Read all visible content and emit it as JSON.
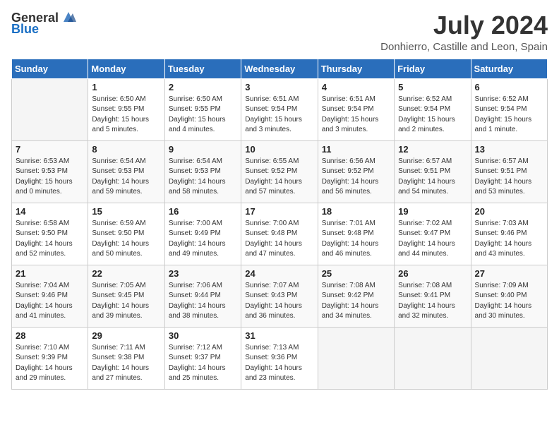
{
  "header": {
    "logo_general": "General",
    "logo_blue": "Blue",
    "month": "July 2024",
    "location": "Donhierro, Castille and Leon, Spain"
  },
  "weekdays": [
    "Sunday",
    "Monday",
    "Tuesday",
    "Wednesday",
    "Thursday",
    "Friday",
    "Saturday"
  ],
  "weeks": [
    [
      {
        "day": "",
        "sunrise": "",
        "sunset": "",
        "daylight": ""
      },
      {
        "day": "1",
        "sunrise": "Sunrise: 6:50 AM",
        "sunset": "Sunset: 9:55 PM",
        "daylight": "Daylight: 15 hours and 5 minutes."
      },
      {
        "day": "2",
        "sunrise": "Sunrise: 6:50 AM",
        "sunset": "Sunset: 9:55 PM",
        "daylight": "Daylight: 15 hours and 4 minutes."
      },
      {
        "day": "3",
        "sunrise": "Sunrise: 6:51 AM",
        "sunset": "Sunset: 9:54 PM",
        "daylight": "Daylight: 15 hours and 3 minutes."
      },
      {
        "day": "4",
        "sunrise": "Sunrise: 6:51 AM",
        "sunset": "Sunset: 9:54 PM",
        "daylight": "Daylight: 15 hours and 3 minutes."
      },
      {
        "day": "5",
        "sunrise": "Sunrise: 6:52 AM",
        "sunset": "Sunset: 9:54 PM",
        "daylight": "Daylight: 15 hours and 2 minutes."
      },
      {
        "day": "6",
        "sunrise": "Sunrise: 6:52 AM",
        "sunset": "Sunset: 9:54 PM",
        "daylight": "Daylight: 15 hours and 1 minute."
      }
    ],
    [
      {
        "day": "7",
        "sunrise": "Sunrise: 6:53 AM",
        "sunset": "Sunset: 9:53 PM",
        "daylight": "Daylight: 15 hours and 0 minutes."
      },
      {
        "day": "8",
        "sunrise": "Sunrise: 6:54 AM",
        "sunset": "Sunset: 9:53 PM",
        "daylight": "Daylight: 14 hours and 59 minutes."
      },
      {
        "day": "9",
        "sunrise": "Sunrise: 6:54 AM",
        "sunset": "Sunset: 9:53 PM",
        "daylight": "Daylight: 14 hours and 58 minutes."
      },
      {
        "day": "10",
        "sunrise": "Sunrise: 6:55 AM",
        "sunset": "Sunset: 9:52 PM",
        "daylight": "Daylight: 14 hours and 57 minutes."
      },
      {
        "day": "11",
        "sunrise": "Sunrise: 6:56 AM",
        "sunset": "Sunset: 9:52 PM",
        "daylight": "Daylight: 14 hours and 56 minutes."
      },
      {
        "day": "12",
        "sunrise": "Sunrise: 6:57 AM",
        "sunset": "Sunset: 9:51 PM",
        "daylight": "Daylight: 14 hours and 54 minutes."
      },
      {
        "day": "13",
        "sunrise": "Sunrise: 6:57 AM",
        "sunset": "Sunset: 9:51 PM",
        "daylight": "Daylight: 14 hours and 53 minutes."
      }
    ],
    [
      {
        "day": "14",
        "sunrise": "Sunrise: 6:58 AM",
        "sunset": "Sunset: 9:50 PM",
        "daylight": "Daylight: 14 hours and 52 minutes."
      },
      {
        "day": "15",
        "sunrise": "Sunrise: 6:59 AM",
        "sunset": "Sunset: 9:50 PM",
        "daylight": "Daylight: 14 hours and 50 minutes."
      },
      {
        "day": "16",
        "sunrise": "Sunrise: 7:00 AM",
        "sunset": "Sunset: 9:49 PM",
        "daylight": "Daylight: 14 hours and 49 minutes."
      },
      {
        "day": "17",
        "sunrise": "Sunrise: 7:00 AM",
        "sunset": "Sunset: 9:48 PM",
        "daylight": "Daylight: 14 hours and 47 minutes."
      },
      {
        "day": "18",
        "sunrise": "Sunrise: 7:01 AM",
        "sunset": "Sunset: 9:48 PM",
        "daylight": "Daylight: 14 hours and 46 minutes."
      },
      {
        "day": "19",
        "sunrise": "Sunrise: 7:02 AM",
        "sunset": "Sunset: 9:47 PM",
        "daylight": "Daylight: 14 hours and 44 minutes."
      },
      {
        "day": "20",
        "sunrise": "Sunrise: 7:03 AM",
        "sunset": "Sunset: 9:46 PM",
        "daylight": "Daylight: 14 hours and 43 minutes."
      }
    ],
    [
      {
        "day": "21",
        "sunrise": "Sunrise: 7:04 AM",
        "sunset": "Sunset: 9:46 PM",
        "daylight": "Daylight: 14 hours and 41 minutes."
      },
      {
        "day": "22",
        "sunrise": "Sunrise: 7:05 AM",
        "sunset": "Sunset: 9:45 PM",
        "daylight": "Daylight: 14 hours and 39 minutes."
      },
      {
        "day": "23",
        "sunrise": "Sunrise: 7:06 AM",
        "sunset": "Sunset: 9:44 PM",
        "daylight": "Daylight: 14 hours and 38 minutes."
      },
      {
        "day": "24",
        "sunrise": "Sunrise: 7:07 AM",
        "sunset": "Sunset: 9:43 PM",
        "daylight": "Daylight: 14 hours and 36 minutes."
      },
      {
        "day": "25",
        "sunrise": "Sunrise: 7:08 AM",
        "sunset": "Sunset: 9:42 PM",
        "daylight": "Daylight: 14 hours and 34 minutes."
      },
      {
        "day": "26",
        "sunrise": "Sunrise: 7:08 AM",
        "sunset": "Sunset: 9:41 PM",
        "daylight": "Daylight: 14 hours and 32 minutes."
      },
      {
        "day": "27",
        "sunrise": "Sunrise: 7:09 AM",
        "sunset": "Sunset: 9:40 PM",
        "daylight": "Daylight: 14 hours and 30 minutes."
      }
    ],
    [
      {
        "day": "28",
        "sunrise": "Sunrise: 7:10 AM",
        "sunset": "Sunset: 9:39 PM",
        "daylight": "Daylight: 14 hours and 29 minutes."
      },
      {
        "day": "29",
        "sunrise": "Sunrise: 7:11 AM",
        "sunset": "Sunset: 9:38 PM",
        "daylight": "Daylight: 14 hours and 27 minutes."
      },
      {
        "day": "30",
        "sunrise": "Sunrise: 7:12 AM",
        "sunset": "Sunset: 9:37 PM",
        "daylight": "Daylight: 14 hours and 25 minutes."
      },
      {
        "day": "31",
        "sunrise": "Sunrise: 7:13 AM",
        "sunset": "Sunset: 9:36 PM",
        "daylight": "Daylight: 14 hours and 23 minutes."
      },
      {
        "day": "",
        "sunrise": "",
        "sunset": "",
        "daylight": ""
      },
      {
        "day": "",
        "sunrise": "",
        "sunset": "",
        "daylight": ""
      },
      {
        "day": "",
        "sunrise": "",
        "sunset": "",
        "daylight": ""
      }
    ]
  ]
}
